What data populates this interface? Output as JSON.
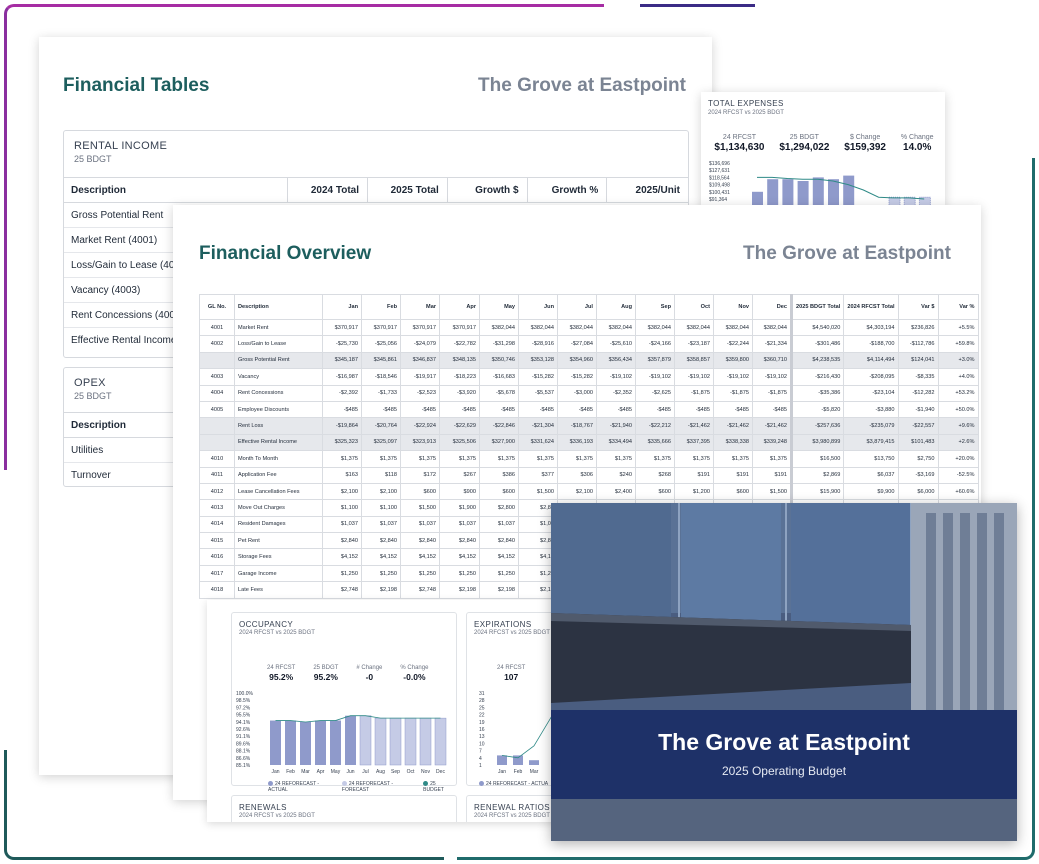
{
  "brand": "The Grove at Eastpoint",
  "financial_tables": {
    "title": "Financial Tables",
    "rental_income": {
      "title": "RENTAL INCOME",
      "subtitle": "25 BDGT",
      "columns": [
        "Description",
        "2024 Total",
        "2025 Total",
        "Growth $",
        "Growth %",
        "2025/Unit"
      ],
      "rows": [
        "Gross Potential Rent",
        "Market Rent (4001)",
        "Loss/Gain to Lease (4002)",
        "Vacancy (4003)",
        "Rent Concessions (4004)",
        "Effective Rental Income"
      ]
    },
    "opex": {
      "title": "OPEX",
      "subtitle": "25 BDGT",
      "columns": [
        "Description"
      ],
      "rows": [
        "Utilities",
        "Turnover"
      ]
    }
  },
  "total_expenses": {
    "title": "TOTAL EXPENSES",
    "subtitle": "2024 RFCST vs 2025 BDGT",
    "stats": [
      {
        "label": "24 RFCST",
        "value": "$1,134,630"
      },
      {
        "label": "25 BDGT",
        "value": "$1,294,022"
      },
      {
        "label": "$ Change",
        "value": "$159,392"
      },
      {
        "label": "% Change",
        "value": "14.0%"
      }
    ],
    "y_ticks": [
      "$136,696",
      "$127,631",
      "$118,564",
      "$109,498",
      "$100,431",
      "$91,364"
    ],
    "actual_bars_rel": [
      0.45,
      0.8,
      0.8,
      0.75,
      0.85,
      0.8,
      0.9
    ],
    "forecast_bars_rel": [
      0.3,
      0.3,
      0.3
    ],
    "line_rel": [
      0.85,
      0.85,
      0.82,
      0.8,
      0.8,
      0.75,
      0.65,
      0.5,
      0.3,
      0.28,
      0.28,
      0.25
    ]
  },
  "financial_overview": {
    "title": "Financial Overview",
    "columns": [
      "GL No.",
      "Description",
      "Jan",
      "Feb",
      "Mar",
      "Apr",
      "May",
      "Jun",
      "Jul",
      "Aug",
      "Sep",
      "Oct",
      "Nov",
      "Dec",
      "2025 BDGT Total",
      "2024 RFCST Total",
      "Var $",
      "Var %"
    ],
    "rows": [
      {
        "subtotal": false,
        "cells": [
          "4001",
          "Market Rent",
          "$370,917",
          "$370,917",
          "$370,917",
          "$370,917",
          "$382,044",
          "$382,044",
          "$382,044",
          "$382,044",
          "$382,044",
          "$382,044",
          "$382,044",
          "$382,044",
          "$4,540,020",
          "$4,303,194",
          "$236,826",
          "+5.5%"
        ]
      },
      {
        "subtotal": false,
        "cells": [
          "4002",
          "Loss/Gain to Lease",
          "-$25,730",
          "-$25,056",
          "-$24,079",
          "-$22,782",
          "-$31,298",
          "-$28,916",
          "-$27,084",
          "-$25,610",
          "-$24,166",
          "-$23,187",
          "-$22,244",
          "-$21,334",
          "-$301,486",
          "-$188,700",
          "-$112,786",
          "+59.8%"
        ]
      },
      {
        "subtotal": true,
        "cells": [
          "",
          "Gross Potential Rent",
          "$345,187",
          "$345,861",
          "$346,837",
          "$348,135",
          "$350,746",
          "$353,128",
          "$354,960",
          "$356,434",
          "$357,879",
          "$358,857",
          "$359,800",
          "$360,710",
          "$4,238,535",
          "$4,114,494",
          "$124,041",
          "+3.0%"
        ]
      },
      {
        "subtotal": false,
        "cells": [
          "4003",
          "Vacancy",
          "-$16,987",
          "-$18,546",
          "-$19,917",
          "-$18,223",
          "-$16,683",
          "-$15,282",
          "-$15,282",
          "-$19,102",
          "-$19,102",
          "-$19,102",
          "-$19,102",
          "-$19,102",
          "-$216,430",
          "-$208,095",
          "-$8,335",
          "+4.0%"
        ]
      },
      {
        "subtotal": false,
        "cells": [
          "4004",
          "Rent Concessions",
          "-$2,392",
          "-$1,733",
          "-$2,523",
          "-$3,920",
          "-$5,678",
          "-$5,537",
          "-$3,000",
          "-$2,352",
          "-$2,625",
          "-$1,875",
          "-$1,875",
          "-$1,875",
          "-$35,386",
          "-$23,104",
          "-$12,282",
          "+53.2%"
        ]
      },
      {
        "subtotal": false,
        "cells": [
          "4005",
          "Employee Discounts",
          "-$485",
          "-$485",
          "-$485",
          "-$485",
          "-$485",
          "-$485",
          "-$485",
          "-$485",
          "-$485",
          "-$485",
          "-$485",
          "-$485",
          "-$5,820",
          "-$3,880",
          "-$1,940",
          "+50.0%"
        ]
      },
      {
        "subtotal": true,
        "cells": [
          "",
          "Rent Loss",
          "-$19,864",
          "-$20,764",
          "-$22,924",
          "-$22,629",
          "-$22,846",
          "-$21,304",
          "-$18,767",
          "-$21,940",
          "-$22,212",
          "-$21,462",
          "-$21,462",
          "-$21,462",
          "-$257,636",
          "-$235,079",
          "-$22,557",
          "+9.6%"
        ]
      },
      {
        "subtotal": true,
        "cells": [
          "",
          "Effective Rental Income",
          "$325,323",
          "$325,097",
          "$323,913",
          "$325,506",
          "$327,900",
          "$331,624",
          "$336,193",
          "$334,494",
          "$335,666",
          "$337,395",
          "$338,338",
          "$339,248",
          "$3,980,899",
          "$3,879,415",
          "$101,483",
          "+2.6%"
        ]
      },
      {
        "subtotal": false,
        "cells": [
          "4010",
          "Month To Month",
          "$1,375",
          "$1,375",
          "$1,375",
          "$1,375",
          "$1,375",
          "$1,375",
          "$1,375",
          "$1,375",
          "$1,375",
          "$1,375",
          "$1,375",
          "$1,375",
          "$16,500",
          "$13,750",
          "$2,750",
          "+20.0%"
        ]
      },
      {
        "subtotal": false,
        "cells": [
          "4011",
          "Application Fee",
          "$163",
          "$118",
          "$172",
          "$267",
          "$386",
          "$377",
          "$306",
          "$240",
          "$268",
          "$191",
          "$191",
          "$191",
          "$2,869",
          "$6,037",
          "-$3,169",
          "-52.5%"
        ]
      },
      {
        "subtotal": false,
        "cells": [
          "4012",
          "Lease Cancellation Fees",
          "$2,100",
          "$2,100",
          "$600",
          "$900",
          "$600",
          "$1,500",
          "$2,100",
          "$2,400",
          "$600",
          "$1,200",
          "$600",
          "$1,500",
          "$15,900",
          "$9,900",
          "$6,000",
          "+60.6%"
        ]
      },
      {
        "subtotal": false,
        "cells": [
          "4013",
          "Move Out Charges",
          "$1,100",
          "$1,100",
          "$1,500",
          "$1,900",
          "$2,800",
          "$2,80",
          "",
          "",
          "",
          "",
          "",
          "",
          "",
          "",
          "",
          ""
        ]
      },
      {
        "subtotal": false,
        "cells": [
          "4014",
          "Resident Damages",
          "$1,037",
          "$1,037",
          "$1,037",
          "$1,037",
          "$1,037",
          "$1,03",
          "",
          "",
          "",
          "",
          "",
          "",
          "",
          "",
          "",
          ""
        ]
      },
      {
        "subtotal": false,
        "cells": [
          "4015",
          "Pet Rent",
          "$2,840",
          "$2,840",
          "$2,840",
          "$2,840",
          "$2,840",
          "$2,84",
          "",
          "",
          "",
          "",
          "",
          "",
          "",
          "",
          "",
          ""
        ]
      },
      {
        "subtotal": false,
        "cells": [
          "4016",
          "Storage Fees",
          "$4,152",
          "$4,152",
          "$4,152",
          "$4,152",
          "$4,152",
          "$4,15",
          "",
          "",
          "",
          "",
          "",
          "",
          "",
          "",
          "",
          ""
        ]
      },
      {
        "subtotal": false,
        "cells": [
          "4017",
          "Garage Income",
          "$1,250",
          "$1,250",
          "$1,250",
          "$1,250",
          "$1,250",
          "$1,25",
          "",
          "",
          "",
          "",
          "",
          "",
          "",
          "",
          "",
          ""
        ]
      },
      {
        "subtotal": false,
        "cells": [
          "4018",
          "Late Fees",
          "$2,748",
          "$2,198",
          "$2,748",
          "$2,198",
          "$2,198",
          "$2,19",
          "",
          "",
          "",
          "",
          "",
          "",
          "",
          "",
          "",
          ""
        ]
      }
    ]
  },
  "occupancy": {
    "title": "OCCUPANCY",
    "subtitle": "2024 RFCST vs 2025 BDGT",
    "stats": [
      {
        "label": "24 RFCST",
        "value": "95.2%"
      },
      {
        "label": "25 BDGT",
        "value": "95.2%"
      },
      {
        "label": "# Change",
        "value": "-0"
      },
      {
        "label": "% Change",
        "value": "-0.0%"
      }
    ],
    "y_ticks": [
      "100.0%",
      "98.5%",
      "97.2%",
      "95.5%",
      "94.1%",
      "92.6%",
      "91.1%",
      "89.6%",
      "88.1%",
      "86.6%",
      "85.1%"
    ],
    "months": [
      "Jan",
      "Feb",
      "Mar",
      "Apr",
      "May",
      "Jun",
      "Jul",
      "Aug",
      "Sep",
      "Oct",
      "Nov",
      "Dec"
    ],
    "values": [
      94.3,
      94.3,
      94.0,
      94.3,
      94.3,
      95.3,
      95.3,
      94.8,
      94.8,
      94.8,
      94.8,
      94.8
    ],
    "legend": [
      "24 REFORECAST - ACTUAL",
      "24 REFORECAST - FORECAST",
      "25 BUDGET"
    ]
  },
  "expirations": {
    "title": "EXPIRATIONS",
    "subtitle": "2024 RFCST vs 2025 BDGT",
    "stats": [
      {
        "label": "24 RFCST",
        "value": "107"
      }
    ],
    "y_ticks": [
      "31",
      "28",
      "25",
      "22",
      "19",
      "16",
      "13",
      "10",
      "7",
      "4",
      "1"
    ],
    "months": [
      "Jan",
      "Feb",
      "Mar"
    ],
    "legend": [
      "24 REFORECAST - ACTUA"
    ]
  },
  "renewals": {
    "title": "RENEWALS",
    "subtitle": "2024 RFCST vs 2025 BDGT"
  },
  "renewal_ratios": {
    "title": "RENEWAL RATIOS",
    "subtitle": "2024 RFCST vs 2025 BDGT"
  },
  "cover": {
    "title": "The Grove at Eastpoint",
    "subtitle": "2025 Operating Budget"
  },
  "colors": {
    "accent_teal": "#1d5e5e",
    "bar": "#8f9acb",
    "bar_forecast": "#c5cbe6",
    "line": "#2f8a87",
    "cover_band": "#1e3168"
  }
}
